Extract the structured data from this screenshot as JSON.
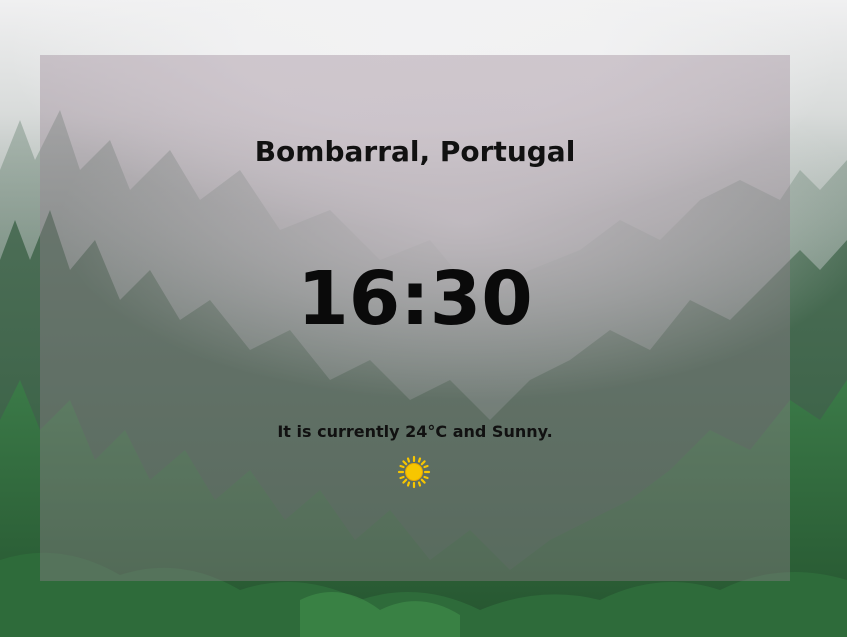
{
  "location": {
    "label": "Bombarral, Portugal"
  },
  "clock": {
    "time": "16:30"
  },
  "weather": {
    "summary": "It is currently 24°C and Sunny.",
    "icon": "sun-icon",
    "icon_color": "#f7c600"
  },
  "colors": {
    "panel_overlay": "#96829160",
    "text": "#111111"
  }
}
